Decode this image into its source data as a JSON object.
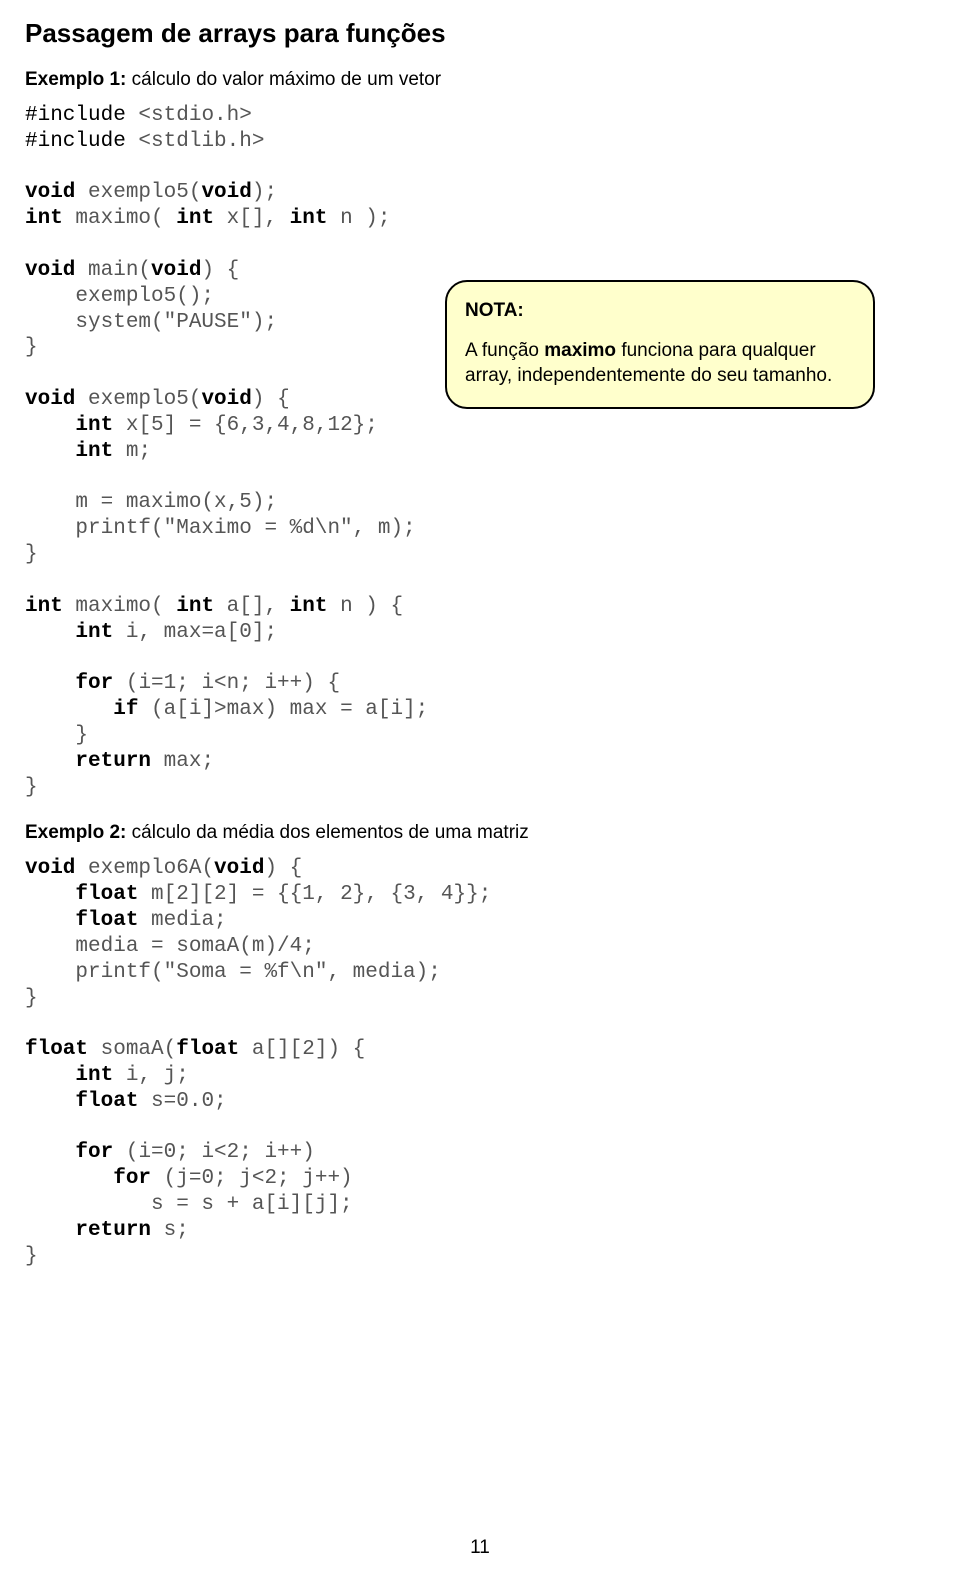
{
  "heading": "Passagem de arrays para funções",
  "example1": {
    "prefix": "Exemplo 1:",
    "text": " cálculo do valor máximo de um vetor"
  },
  "note": {
    "title": "NOTA:",
    "body_pre": "A função ",
    "body_bold": "maximo",
    "body_post": " funciona para qualquer array, independentemente do seu tamanho."
  },
  "code1": {
    "l1a": "#include",
    "l1b": " <stdio.h>",
    "l2a": "#include",
    "l2b": " <stdlib.h>",
    "l3": "",
    "l4a": "void",
    "l4b": " exemplo5(",
    "l4c": "void",
    "l4d": ");",
    "l5a": "int",
    "l5b": " maximo( ",
    "l5c": "int",
    "l5d": " x[], ",
    "l5e": "int",
    "l5f": " n );",
    "l6": "",
    "l7a": "void",
    "l7b": " main(",
    "l7c": "void",
    "l7d": ") {",
    "l8": "    exemplo5();",
    "l9": "    system(\"PAUSE\");",
    "l10": "}",
    "l11": "",
    "l12a": "void",
    "l12b": " exemplo5(",
    "l12c": "void",
    "l12d": ") {",
    "l13a": "    ",
    "l13b": "int",
    "l13c": " x[5] = {6,3,4,8,12};",
    "l14a": "    ",
    "l14b": "int",
    "l14c": " m;",
    "l15": "",
    "l16": "    m = maximo(x,5);",
    "l17": "    printf(\"Maximo = %d\\n\", m);",
    "l18": "}",
    "l19": "",
    "l20a": "int",
    "l20b": " maximo( ",
    "l20c": "int",
    "l20d": " a[], ",
    "l20e": "int",
    "l20f": " n ) {",
    "l21a": "    ",
    "l21b": "int",
    "l21c": " i, max=a[0];",
    "l22": "",
    "l23a": "    ",
    "l23b": "for",
    "l23c": " (i=1; i<n; i++) {",
    "l24a": "       ",
    "l24b": "if",
    "l24c": " (a[i]>max) max = a[i];",
    "l25": "    }",
    "l26a": "    ",
    "l26b": "return",
    "l26c": " max;",
    "l27": "}"
  },
  "example2": {
    "prefix": "Exemplo 2:",
    "text": " cálculo da média dos elementos de uma matriz"
  },
  "code2": {
    "l1a": "void",
    "l1b": " exemplo6A(",
    "l1c": "void",
    "l1d": ") {",
    "l2a": "    ",
    "l2b": "float",
    "l2c": " m[2][2] = {{1, 2}, {3, 4}};",
    "l3a": "    ",
    "l3b": "float",
    "l3c": " media;",
    "l4": "    media = somaA(m)/4;",
    "l5": "    printf(\"Soma = %f\\n\", media);",
    "l6": "}",
    "l7": "",
    "l8a": "float",
    "l8b": " somaA(",
    "l8c": "float",
    "l8d": " a[][2]) {",
    "l9a": "    ",
    "l9b": "int",
    "l9c": " i, j;",
    "l10a": "    ",
    "l10b": "float",
    "l10c": " s=0.0;",
    "l11": "",
    "l12a": "    ",
    "l12b": "for",
    "l12c": " (i=0; i<2; i++)",
    "l13a": "       ",
    "l13b": "for",
    "l13c": " (j=0; j<2; j++)",
    "l14": "          s = s + a[i][j];",
    "l15a": "    ",
    "l15b": "return",
    "l15c": " s;",
    "l16": "}"
  },
  "pageNumber": "11"
}
